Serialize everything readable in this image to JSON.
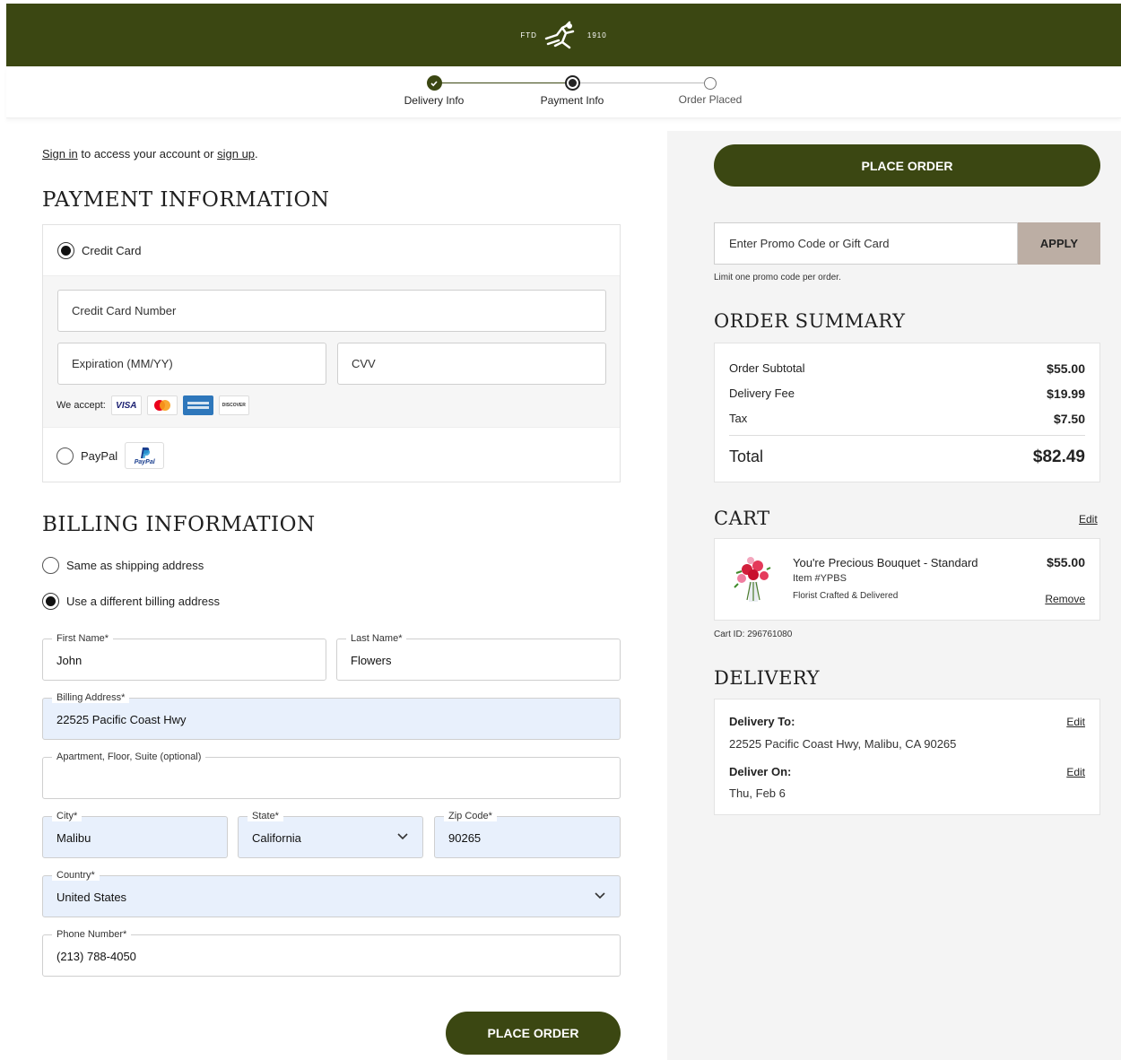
{
  "colors": {
    "brand": "#3b4712",
    "accent": "#bcaea4",
    "filled_field": "#e8f0fc"
  },
  "header": {
    "logo_left": "FTD",
    "logo_right": "1910"
  },
  "steps": [
    {
      "label": "Delivery Info",
      "state": "done"
    },
    {
      "label": "Payment Info",
      "state": "current"
    },
    {
      "label": "Order Placed",
      "state": "pending"
    }
  ],
  "signin": {
    "link1": "Sign in",
    "mid": " to access your account or ",
    "link2": "sign up",
    "end": "."
  },
  "payment": {
    "title": "PAYMENT INFORMATION",
    "credit_label": "Credit Card",
    "card_number_placeholder": "Credit Card Number",
    "expiration_placeholder": "Expiration (MM/YY)",
    "cvv_placeholder": "CVV",
    "we_accept": "We accept:",
    "cards": [
      "VISA",
      "MC",
      "AMEX",
      "DISCOVER"
    ],
    "paypal_label": "PayPal",
    "paypal_logo": "PayPal"
  },
  "billing": {
    "title": "BILLING INFORMATION",
    "same_label": "Same as shipping address",
    "diff_label": "Use a different billing address",
    "fields": {
      "first_name": {
        "label": "First Name*",
        "value": "John"
      },
      "last_name": {
        "label": "Last Name*",
        "value": "Flowers"
      },
      "address": {
        "label": "Billing Address*",
        "value": "22525 Pacific Coast Hwy"
      },
      "apt": {
        "label": "Apartment, Floor, Suite (optional)",
        "value": ""
      },
      "city": {
        "label": "City*",
        "value": "Malibu"
      },
      "state": {
        "label": "State*",
        "value": "California"
      },
      "zip": {
        "label": "Zip Code*",
        "value": "90265"
      },
      "country": {
        "label": "Country*",
        "value": "United States"
      },
      "phone": {
        "label": "Phone Number*",
        "value": "(213) 788-4050"
      }
    }
  },
  "buttons": {
    "place_order": "PLACE ORDER",
    "apply": "APPLY"
  },
  "promo": {
    "placeholder": "Enter Promo Code or Gift Card",
    "limit": "Limit one promo code per order."
  },
  "summary": {
    "title": "ORDER SUMMARY",
    "rows": [
      {
        "label": "Order Subtotal",
        "value": "$55.00"
      },
      {
        "label": "Delivery Fee",
        "value": "$19.99"
      },
      {
        "label": "Tax",
        "value": "$7.50"
      }
    ],
    "total_label": "Total",
    "total_value": "$82.49"
  },
  "cart": {
    "title": "CART",
    "edit": "Edit",
    "item_name": "You're Precious Bouquet - Standard",
    "item_number": "Item #YPBS",
    "item_desc": "Florist Crafted & Delivered",
    "item_price": "$55.00",
    "remove": "Remove",
    "cart_id": "Cart ID: 296761080"
  },
  "delivery": {
    "title": "DELIVERY",
    "to_label": "Delivery To:",
    "to_value": "22525 Pacific Coast Hwy, Malibu, CA 90265",
    "on_label": "Deliver On:",
    "on_value": "Thu, Feb 6",
    "edit": "Edit"
  }
}
